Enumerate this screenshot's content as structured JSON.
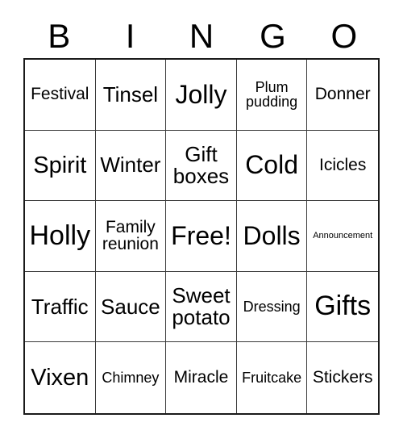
{
  "card": {
    "title_letters": [
      "B",
      "I",
      "N",
      "G",
      "O"
    ],
    "rows": [
      [
        {
          "label": "Festival",
          "size": "s-sm"
        },
        {
          "label": "Tinsel",
          "size": "s-md"
        },
        {
          "label": "Jolly",
          "size": "s-xl"
        },
        {
          "label": "Plum pudding",
          "size": "s-xs"
        },
        {
          "label": "Donner",
          "size": "s-sm"
        }
      ],
      [
        {
          "label": "Spirit",
          "size": "s-lg"
        },
        {
          "label": "Winter",
          "size": "s-md"
        },
        {
          "label": "Gift boxes",
          "size": "s-md"
        },
        {
          "label": "Cold",
          "size": "s-xl"
        },
        {
          "label": "Icicles",
          "size": "s-sm"
        }
      ],
      [
        {
          "label": "Holly",
          "size": "s-xxl"
        },
        {
          "label": "Family reunion",
          "size": "s-sm"
        },
        {
          "label": "Free!",
          "size": "s-xl"
        },
        {
          "label": "Dolls",
          "size": "s-xl"
        },
        {
          "label": "Announcement",
          "size": "s-xxs"
        }
      ],
      [
        {
          "label": "Traffic",
          "size": "s-md"
        },
        {
          "label": "Sauce",
          "size": "s-md"
        },
        {
          "label": "Sweet potato",
          "size": "s-md"
        },
        {
          "label": "Dressing",
          "size": "s-xs"
        },
        {
          "label": "Gifts",
          "size": "s-xxl"
        }
      ],
      [
        {
          "label": "Vixen",
          "size": "s-lg"
        },
        {
          "label": "Chimney",
          "size": "s-xs"
        },
        {
          "label": "Miracle",
          "size": "s-sm"
        },
        {
          "label": "Fruitcake",
          "size": "s-xs"
        },
        {
          "label": "Stickers",
          "size": "s-sm"
        }
      ]
    ],
    "colors": {
      "background": "#ffffff",
      "text": "#000000",
      "outer_border": "#1a1a1a",
      "inner_border": "#3a3a3a"
    }
  }
}
